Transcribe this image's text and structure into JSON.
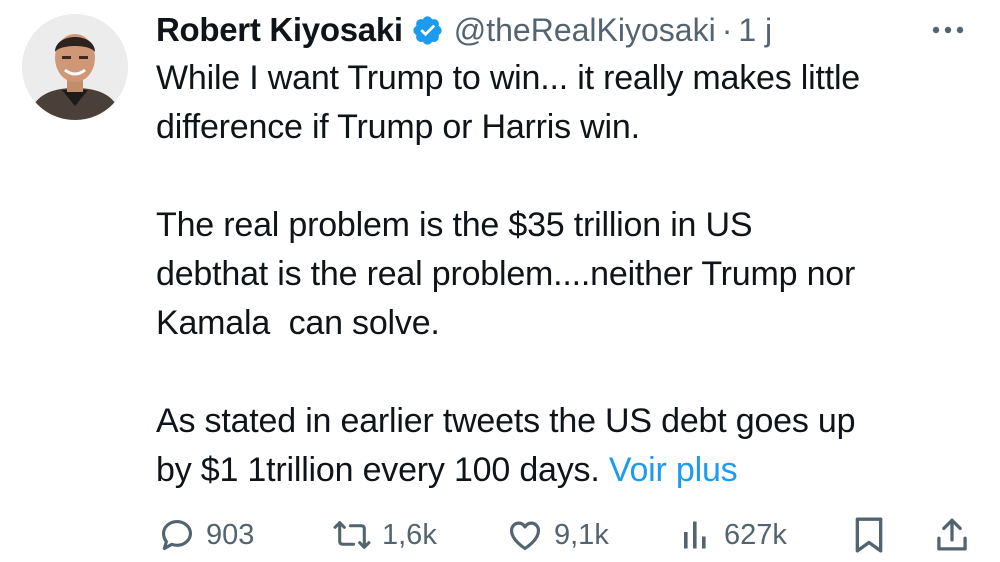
{
  "tweet": {
    "author": {
      "display_name": "Robert Kiyosaki",
      "handle": "@theRealKiyosaki",
      "verified_icon": "verified-badge-icon",
      "avatar": "author-avatar"
    },
    "separator": "·",
    "time": "1 j",
    "more_icon": "more-options-icon",
    "text": {
      "line1": "While I want Trump to win... it really makes little",
      "line2": "difference if Trump or Harris win.",
      "line3": "The real problem is the $35 trillion in US",
      "line4": "debthat is the real problem....neither Trump nor",
      "line5": "Kamala  can solve.",
      "line6": "As stated in earlier tweets the US debt goes up",
      "line7": "by $1 1trillion every 100 days.",
      "show_more": "Voir plus"
    },
    "actions": {
      "replies": "903",
      "retweets": "1,6k",
      "likes": "9,1k",
      "views": "627k"
    }
  },
  "colors": {
    "text": "#0f1419",
    "secondary": "#536471",
    "link": "#1d9bf0",
    "verified": "#1d9bf0"
  }
}
